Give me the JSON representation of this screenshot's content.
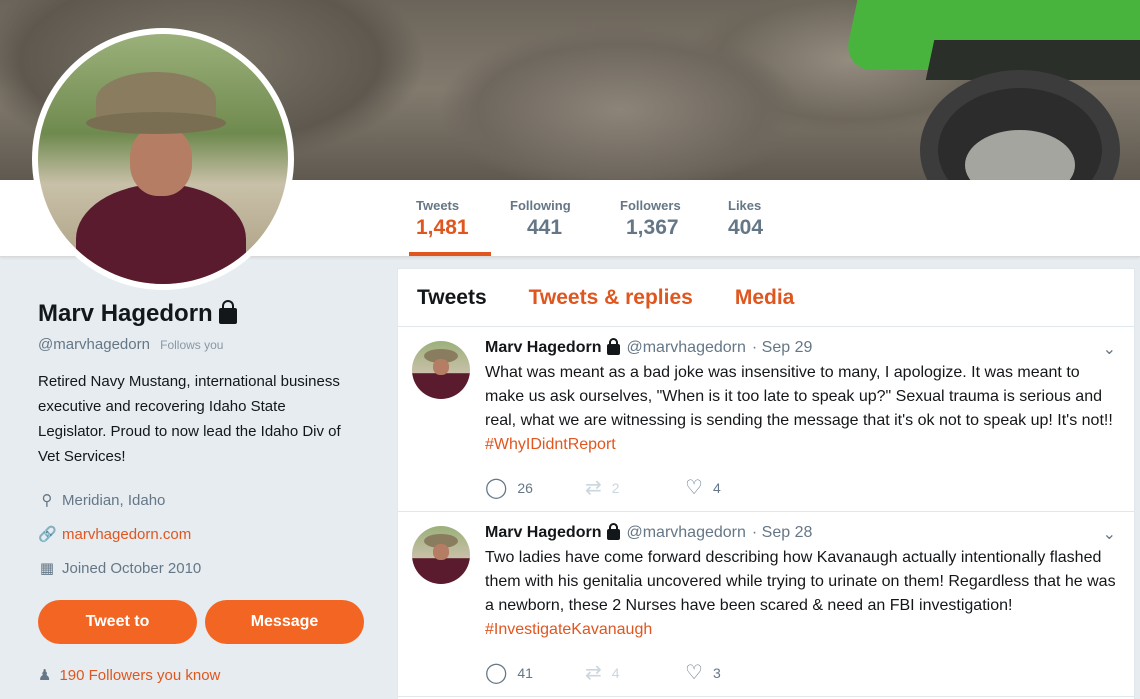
{
  "profile": {
    "name": "Marv Hagedorn",
    "handle": "@marvhagedorn",
    "follows_you": "Follows you",
    "bio": "Retired Navy Mustang, international business executive and recovering Idaho State Legislator. Proud to now lead the Idaho Div of Vet Services!",
    "location": "Meridian, Idaho",
    "website": "marvhagedorn.com",
    "joined": "Joined October 2010",
    "tweet_to": "Tweet to",
    "message": "Message",
    "followers_you_know": "190 Followers you know"
  },
  "stats": [
    {
      "label": "Tweets",
      "value": "1,481"
    },
    {
      "label": "Following",
      "value": "441"
    },
    {
      "label": "Followers",
      "value": "1,367"
    },
    {
      "label": "Likes",
      "value": "404"
    }
  ],
  "tabs": [
    "Tweets",
    "Tweets & replies",
    "Media"
  ],
  "tweets": [
    {
      "name": "Marv Hagedorn",
      "handle": "@marvhagedorn",
      "date": "· Sep 29",
      "text": "What was meant as a bad joke was insensitive to many, I apologize. It was meant to make us ask ourselves, \"When is it too late to speak up?\" Sexual trauma is serious and real, what we are witnessing is sending the message that it's ok not to speak up! It's not!! ",
      "hashtag": "#WhyIDidntReport",
      "replies": "26",
      "retweets": "2",
      "likes": "4"
    },
    {
      "name": "Marv Hagedorn",
      "handle": "@marvhagedorn",
      "date": "· Sep 28",
      "text": "Two ladies have come forward describing how Kavanaugh actually intentionally flashed them with his genitalia uncovered while trying to urinate on them! Regardless that he was a newborn, these 2 Nurses have been scared & need an FBI investigation! ",
      "hashtag": "#InvestigateKavanaugh",
      "replies": "41",
      "retweets": "4",
      "likes": "3"
    }
  ],
  "colors": {
    "accent": "#e0561f",
    "button": "#f26522",
    "muted": "#657786"
  }
}
